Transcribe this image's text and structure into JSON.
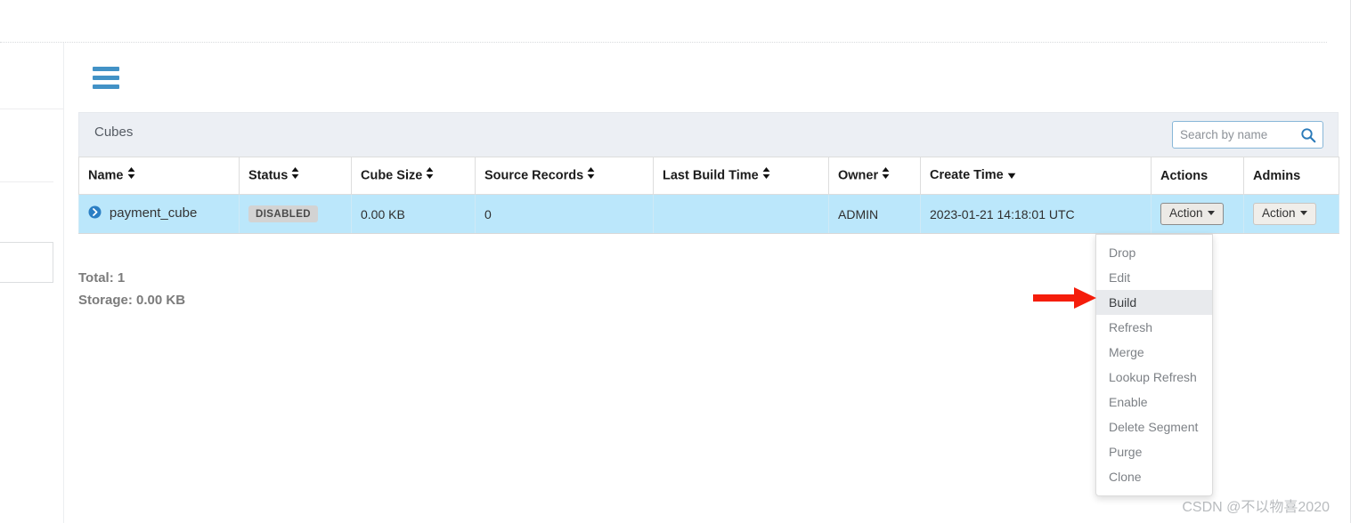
{
  "window": {
    "background_color": "#ffffff"
  },
  "nav": {
    "menu_toggle_icon": "hamburger-icon",
    "accent_color": "#4292c6"
  },
  "panel": {
    "title": "Cubes",
    "header_background": "#eceff4"
  },
  "search": {
    "placeholder": "Search by name",
    "value": "",
    "icon": "search-icon",
    "border_color": "#88b7d8"
  },
  "table": {
    "columns": [
      {
        "label": "Name",
        "sortable": true,
        "sort_state": "none"
      },
      {
        "label": "Status",
        "sortable": true,
        "sort_state": "none"
      },
      {
        "label": "Cube Size",
        "sortable": true,
        "sort_state": "none"
      },
      {
        "label": "Source Records",
        "sortable": true,
        "sort_state": "none"
      },
      {
        "label": "Last Build Time",
        "sortable": true,
        "sort_state": "none"
      },
      {
        "label": "Owner",
        "sortable": true,
        "sort_state": "none"
      },
      {
        "label": "Create Time",
        "sortable": true,
        "sort_state": "desc"
      },
      {
        "label": "Actions",
        "sortable": false,
        "sort_state": "none"
      },
      {
        "label": "Admins",
        "sortable": false,
        "sort_state": "none"
      }
    ],
    "rows": [
      {
        "expand_icon": "chevron-right-circle-icon",
        "name": "payment_cube",
        "status": "DISABLED",
        "cube_size": "0.00 KB",
        "source_records": "0",
        "last_build_time": "",
        "owner": "ADMIN",
        "create_time": "2023-01-21 14:18:01 UTC",
        "actions_label": "Action",
        "admins_label": "Action"
      }
    ],
    "row_highlight_color": "#bbe7fb"
  },
  "summary": {
    "total": "Total: 1",
    "storage": "Storage: 0.00 KB"
  },
  "action_menu": {
    "open": true,
    "highlighted": "Build",
    "items": [
      {
        "label": "Drop"
      },
      {
        "label": "Edit"
      },
      {
        "label": "Build"
      },
      {
        "label": "Refresh"
      },
      {
        "label": "Merge"
      },
      {
        "label": "Lookup Refresh"
      },
      {
        "label": "Enable"
      },
      {
        "label": "Delete Segment"
      },
      {
        "label": "Purge"
      },
      {
        "label": "Clone"
      }
    ]
  },
  "annotation": {
    "arrow_color": "#f51d0b",
    "points_to": "Build"
  },
  "watermark": {
    "text": "CSDN @不以物喜2020"
  }
}
